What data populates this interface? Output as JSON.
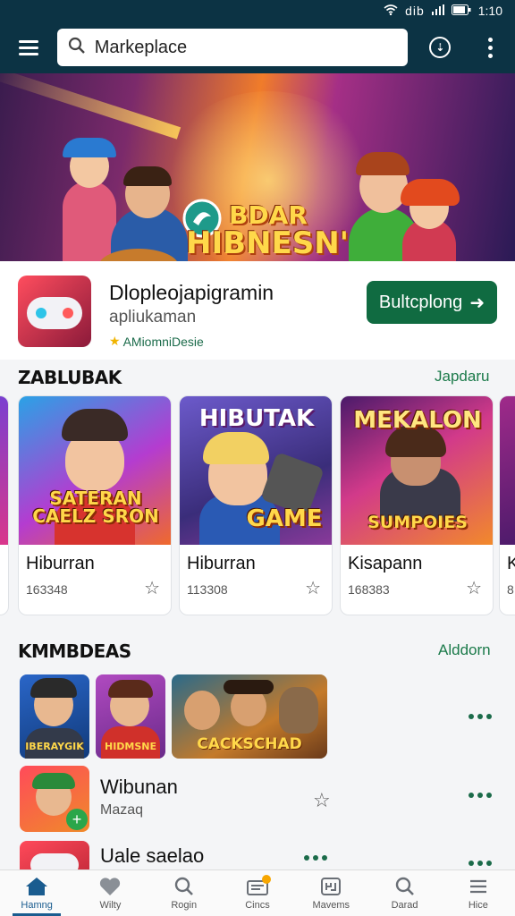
{
  "status": {
    "network": "dib",
    "time": "1:10"
  },
  "search": {
    "value": "Markeplace"
  },
  "hero": {
    "title_line1": "BDAR",
    "title_line2": "HIBNESN'"
  },
  "featured": {
    "name": "Dlopleojapigramin",
    "developer": "apliukaman",
    "badge": "AMiomniDesie",
    "button_label": "Bultcplong"
  },
  "section1": {
    "title": "ZABLUBAK",
    "link": "Japdaru",
    "cards": [
      {
        "art_title": "SATERAN CAELZ SRON",
        "name": "Hiburran",
        "count": "163348"
      },
      {
        "art_title": "HIBUTAK",
        "art_subtitle": "GAME",
        "name": "Hiburran",
        "count": "113308"
      },
      {
        "art_title": "MEKALON",
        "art_subtitle": "SUMPOIES",
        "name": "Kisapann",
        "count": "168383"
      }
    ],
    "partial_name": "K",
    "partial_count": "8"
  },
  "section2": {
    "title": "KMMBDEAS",
    "link": "Alddorn",
    "thumbs": [
      "IBERAYGIK",
      "HIDMSNE",
      "CACKSCHAD"
    ],
    "items": [
      {
        "title": "Wibunan",
        "subtitle": "Mazaq"
      },
      {
        "title": "Uale saelao"
      }
    ]
  },
  "nav": [
    "Hamng",
    "Wilty",
    "Rogin",
    "Cincs",
    "Mavems",
    "Darad",
    "Hice"
  ],
  "colors": {
    "app_bar": "#0c3344",
    "accent_green": "#106b41",
    "nav_active": "#1a5c8f"
  }
}
